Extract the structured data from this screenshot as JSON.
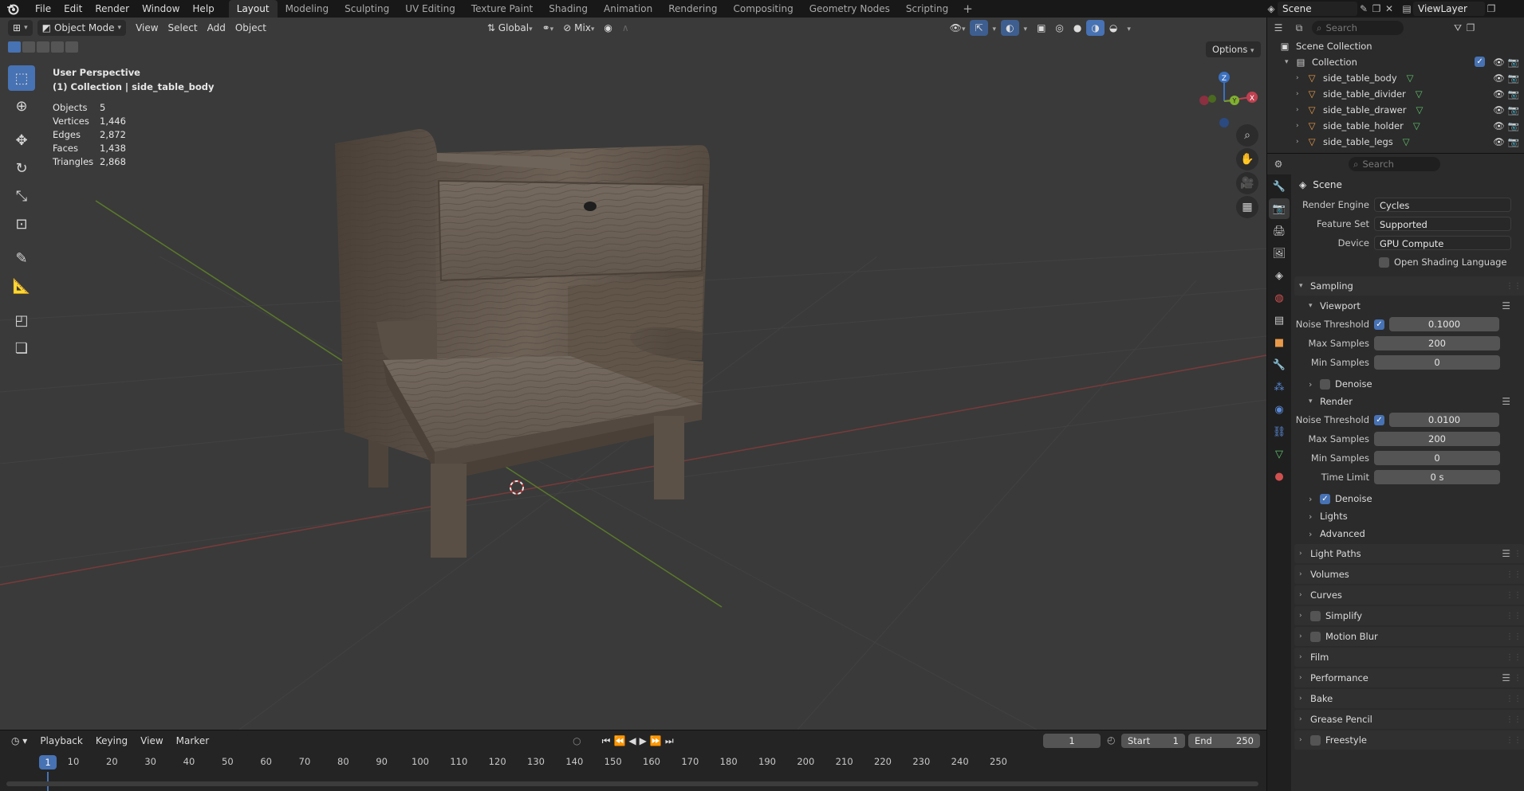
{
  "menus": [
    "File",
    "Edit",
    "Render",
    "Window",
    "Help"
  ],
  "workspaces": [
    "Layout",
    "Modeling",
    "Sculpting",
    "UV Editing",
    "Texture Paint",
    "Shading",
    "Animation",
    "Rendering",
    "Compositing",
    "Geometry Nodes",
    "Scripting"
  ],
  "top_right": {
    "scene": "Scene",
    "view_layer": "ViewLayer"
  },
  "viewport": {
    "mode": "Object Mode",
    "menus": [
      "View",
      "Select",
      "Add",
      "Object"
    ],
    "transform_orientation": "Global",
    "snap_mix": "Mix",
    "options": "Options",
    "perspective": "User Perspective",
    "collection_info": "(1) Collection | side_table_body",
    "stats": [
      {
        "label": "Objects",
        "value": "5"
      },
      {
        "label": "Vertices",
        "value": "1,446"
      },
      {
        "label": "Edges",
        "value": "2,872"
      },
      {
        "label": "Faces",
        "value": "1,438"
      },
      {
        "label": "Triangles",
        "value": "2,868"
      }
    ],
    "gizmo": {
      "x": "X",
      "y": "Y",
      "z": "Z"
    }
  },
  "timeline": {
    "menus": [
      "Playback",
      "Keying",
      "View",
      "Marker"
    ],
    "current_frame": "1",
    "start_label": "Start",
    "start": "1",
    "end_label": "End",
    "end": "250",
    "ticks": [
      "1",
      "10",
      "20",
      "30",
      "40",
      "50",
      "60",
      "70",
      "80",
      "90",
      "100",
      "110",
      "120",
      "130",
      "140",
      "150",
      "160",
      "170",
      "180",
      "190",
      "200",
      "210",
      "220",
      "230",
      "240",
      "250"
    ]
  },
  "outliner": {
    "search_placeholder": "Search",
    "scene_collection": "Scene Collection",
    "collection": "Collection",
    "objects": [
      "side_table_body",
      "side_table_divider",
      "side_table_drawer",
      "side_table_holder",
      "side_table_legs"
    ]
  },
  "properties": {
    "search_placeholder": "Search",
    "scene": "Scene",
    "render_engine_label": "Render Engine",
    "render_engine": "Cycles",
    "feature_set_label": "Feature Set",
    "feature_set": "Supported",
    "device_label": "Device",
    "device": "GPU Compute",
    "osl_label": "Open Shading Language",
    "sampling": "Sampling",
    "viewport": "Viewport",
    "noise_threshold_label": "Noise Threshold",
    "viewport_noise_threshold": "0.1000",
    "max_samples_label": "Max Samples",
    "viewport_max_samples": "200",
    "min_samples_label": "Min Samples",
    "viewport_min_samples": "0",
    "denoise_label": "Denoise",
    "render": "Render",
    "render_noise_threshold": "0.0100",
    "render_max_samples": "200",
    "render_min_samples": "0",
    "time_limit_label": "Time Limit",
    "time_limit": "0 s",
    "lights": "Lights",
    "advanced": "Advanced",
    "panels": [
      "Light Paths",
      "Volumes",
      "Curves",
      "Simplify",
      "Motion Blur",
      "Film",
      "Performance",
      "Bake",
      "Grease Pencil",
      "Freestyle"
    ]
  }
}
